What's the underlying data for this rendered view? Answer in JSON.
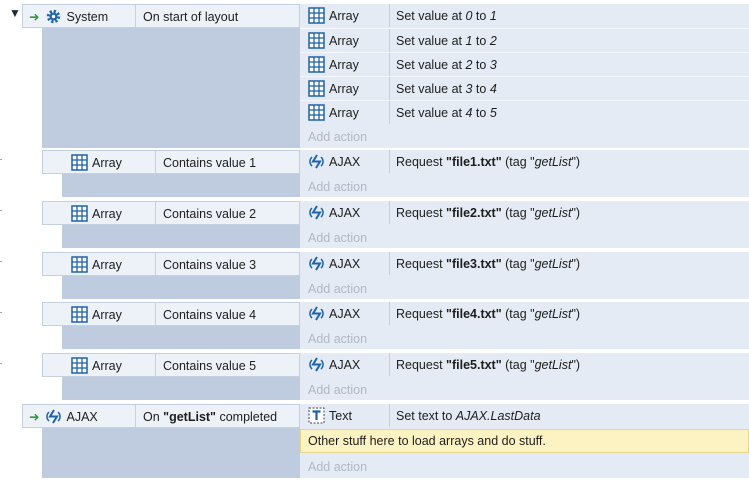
{
  "collapse_icon": "collapse-triangle-icon",
  "event_system": {
    "object": "System",
    "condition": "On start of layout",
    "actions": [
      {
        "object": "Array",
        "text_pre": "Set value at ",
        "a": "0",
        "mid": " to ",
        "b": "1"
      },
      {
        "object": "Array",
        "text_pre": "Set value at ",
        "a": "1",
        "mid": " to ",
        "b": "2"
      },
      {
        "object": "Array",
        "text_pre": "Set value at ",
        "a": "2",
        "mid": " to ",
        "b": "3"
      },
      {
        "object": "Array",
        "text_pre": "Set value at ",
        "a": "3",
        "mid": " to ",
        "b": "4"
      },
      {
        "object": "Array",
        "text_pre": "Set value at ",
        "a": "4",
        "mid": " to ",
        "b": "5"
      }
    ],
    "add_action": "Add action"
  },
  "sub_events": [
    {
      "object": "Array",
      "condition": "Contains value 1",
      "action_object": "AJAX",
      "req": "Request ",
      "file": "\"file1.txt\"",
      "tag_pre": " (tag \"",
      "tag": "getList",
      "tag_post": "\")",
      "add_action": "Add action"
    },
    {
      "object": "Array",
      "condition": "Contains value 2",
      "action_object": "AJAX",
      "req": "Request ",
      "file": "\"file2.txt\"",
      "tag_pre": " (tag \"",
      "tag": "getList",
      "tag_post": "\")",
      "add_action": "Add action"
    },
    {
      "object": "Array",
      "condition": "Contains value 3",
      "action_object": "AJAX",
      "req": "Request ",
      "file": "\"file3.txt\"",
      "tag_pre": " (tag \"",
      "tag": "getList",
      "tag_post": "\")",
      "add_action": "Add action"
    },
    {
      "object": "Array",
      "condition": "Contains value 4",
      "action_object": "AJAX",
      "req": "Request ",
      "file": "\"file4.txt\"",
      "tag_pre": " (tag \"",
      "tag": "getList",
      "tag_post": "\")",
      "add_action": "Add action"
    },
    {
      "object": "Array",
      "condition": "Contains value 5",
      "action_object": "AJAX",
      "req": "Request ",
      "file": "\"file5.txt\"",
      "tag_pre": " (tag \"",
      "tag": "getList",
      "tag_post": "\")",
      "add_action": "Add action"
    }
  ],
  "event_ajax": {
    "object": "AJAX",
    "cond_pre": "On ",
    "cond_bold": "\"getList\"",
    "cond_post": " completed",
    "action_object": "Text",
    "action_pre": "Set text to ",
    "action_italic": "AJAX.LastData",
    "comment": "Other stuff here to load arrays and do stuff.",
    "add_action": "Add action"
  },
  "colors": {
    "condition_block": "#bfcce0",
    "condition_cell": "#edf1f8",
    "action_block": "#e4ebf5",
    "comment_bg": "#fdf3c2",
    "trigger_arrow": "#2d9b3b",
    "grid_icon": "#1f63a8"
  }
}
